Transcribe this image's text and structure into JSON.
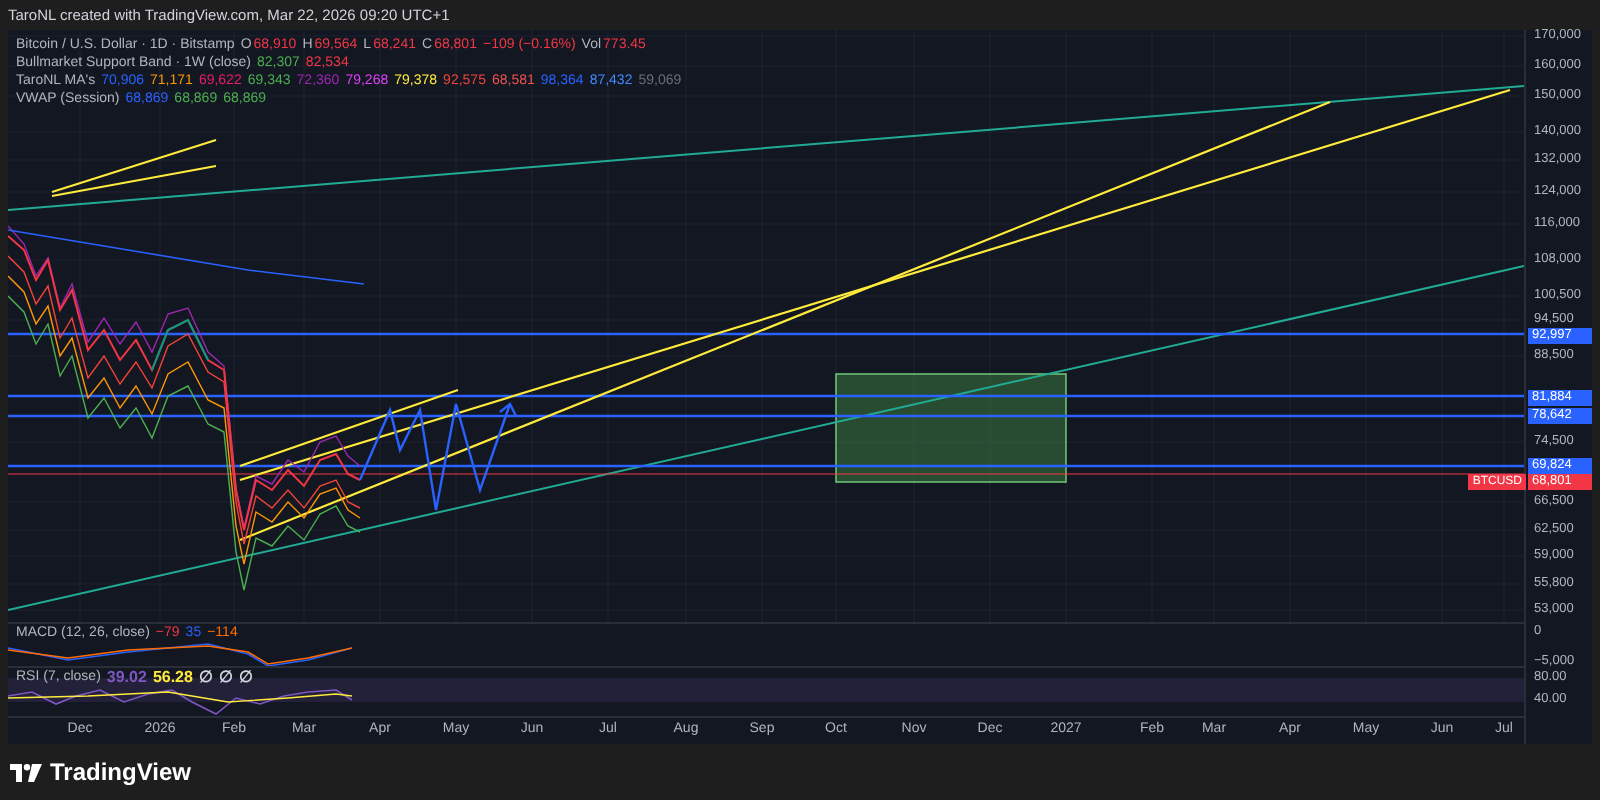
{
  "header": {
    "title": "TaroNL created with TradingView.com, Mar 22, 2026 09:20 UTC+1"
  },
  "legend": [
    {
      "name": "Bitcoin / U.S. Dollar · 1D · Bitstamp",
      "values": [
        {
          "prefix": "O",
          "text": "68,910",
          "color": "#f23645"
        },
        {
          "prefix": "H",
          "text": "69,564",
          "color": "#f23645"
        },
        {
          "prefix": "L",
          "text": "68,241",
          "color": "#f23645"
        },
        {
          "prefix": "C",
          "text": "68,801",
          "color": "#f23645"
        },
        {
          "text": "−109 (−0.16%)",
          "color": "#f23645"
        },
        {
          "prefix": "Vol",
          "text": "773.45",
          "color": "#f23645"
        }
      ]
    },
    {
      "name": "Bullmarket Support Band · 1W (close)",
      "values": [
        {
          "text": "82,307",
          "color": "#4caf50"
        },
        {
          "text": "82,534",
          "color": "#f23645"
        }
      ]
    },
    {
      "name": "TaroNL MA's",
      "values": [
        {
          "text": "70,906",
          "color": "#2962ff"
        },
        {
          "text": "71,171",
          "color": "#ff9800"
        },
        {
          "text": "69,622",
          "color": "#e91e63"
        },
        {
          "text": "69,343",
          "color": "#4caf50"
        },
        {
          "text": "72,360",
          "color": "#9c27b0"
        },
        {
          "text": "79,268",
          "color": "#e040fb"
        },
        {
          "text": "79,378",
          "color": "#ffeb3b"
        },
        {
          "text": "92,575",
          "color": "#f44336"
        },
        {
          "text": "68,581",
          "color": "#ef5350"
        },
        {
          "text": "98,364",
          "color": "#2962ff"
        },
        {
          "text": "87,432",
          "color": "#448aff"
        },
        {
          "text": "59,069",
          "color": "#6a6d78"
        }
      ]
    },
    {
      "name": "VWAP (Session)",
      "values": [
        {
          "text": "68,869",
          "color": "#2962ff"
        },
        {
          "text": "68,869",
          "color": "#4caf50"
        },
        {
          "text": "68,869",
          "color": "#4caf50"
        }
      ]
    }
  ],
  "price_axis": {
    "ticks": [
      "170,000",
      "160,000",
      "150,000",
      "140,000",
      "132,000",
      "124,000",
      "116,000",
      "108,000",
      "100,500",
      "94,500",
      "88,500",
      "74,500",
      "66,500",
      "62,500",
      "59,000",
      "55,800",
      "53,000"
    ],
    "tags": [
      {
        "text": "92,997",
        "color": "#2962ff"
      },
      {
        "text": "81,884",
        "color": "#2962ff"
      },
      {
        "text": "78,642",
        "color": "#2962ff"
      },
      {
        "text": "69,824",
        "color": "#2962ff"
      },
      {
        "text": "68,801",
        "color": "#f23645",
        "symbol": "BTCUSD"
      }
    ]
  },
  "macd": {
    "label": "MACD (12, 26, close)",
    "values": [
      {
        "text": "−79",
        "color": "#f23645"
      },
      {
        "text": "35",
        "color": "#2962ff"
      },
      {
        "text": "−114",
        "color": "#ff6d00"
      }
    ],
    "axis_ticks": [
      "0",
      "−5,000"
    ]
  },
  "rsi": {
    "label": "RSI (7, close)",
    "values": [
      {
        "text": "39.02",
        "color": "#7e57c2"
      },
      {
        "text": "56.28",
        "color": "#ffeb3b"
      },
      {
        "text": "∅",
        "color": "#d1d4dc"
      },
      {
        "text": "∅",
        "color": "#d1d4dc"
      },
      {
        "text": "∅",
        "color": "#d1d4dc"
      }
    ],
    "axis_ticks": [
      "80.00",
      "40.00"
    ]
  },
  "time_axis": {
    "ticks": [
      "Dec",
      "2026",
      "Feb",
      "Mar",
      "Apr",
      "May",
      "Jun",
      "Jul",
      "Aug",
      "Sep",
      "Oct",
      "Nov",
      "Dec",
      "2027",
      "Feb",
      "Mar",
      "Apr",
      "May",
      "Jun",
      "Jul"
    ]
  },
  "footer": {
    "brand": "TradingView"
  }
}
